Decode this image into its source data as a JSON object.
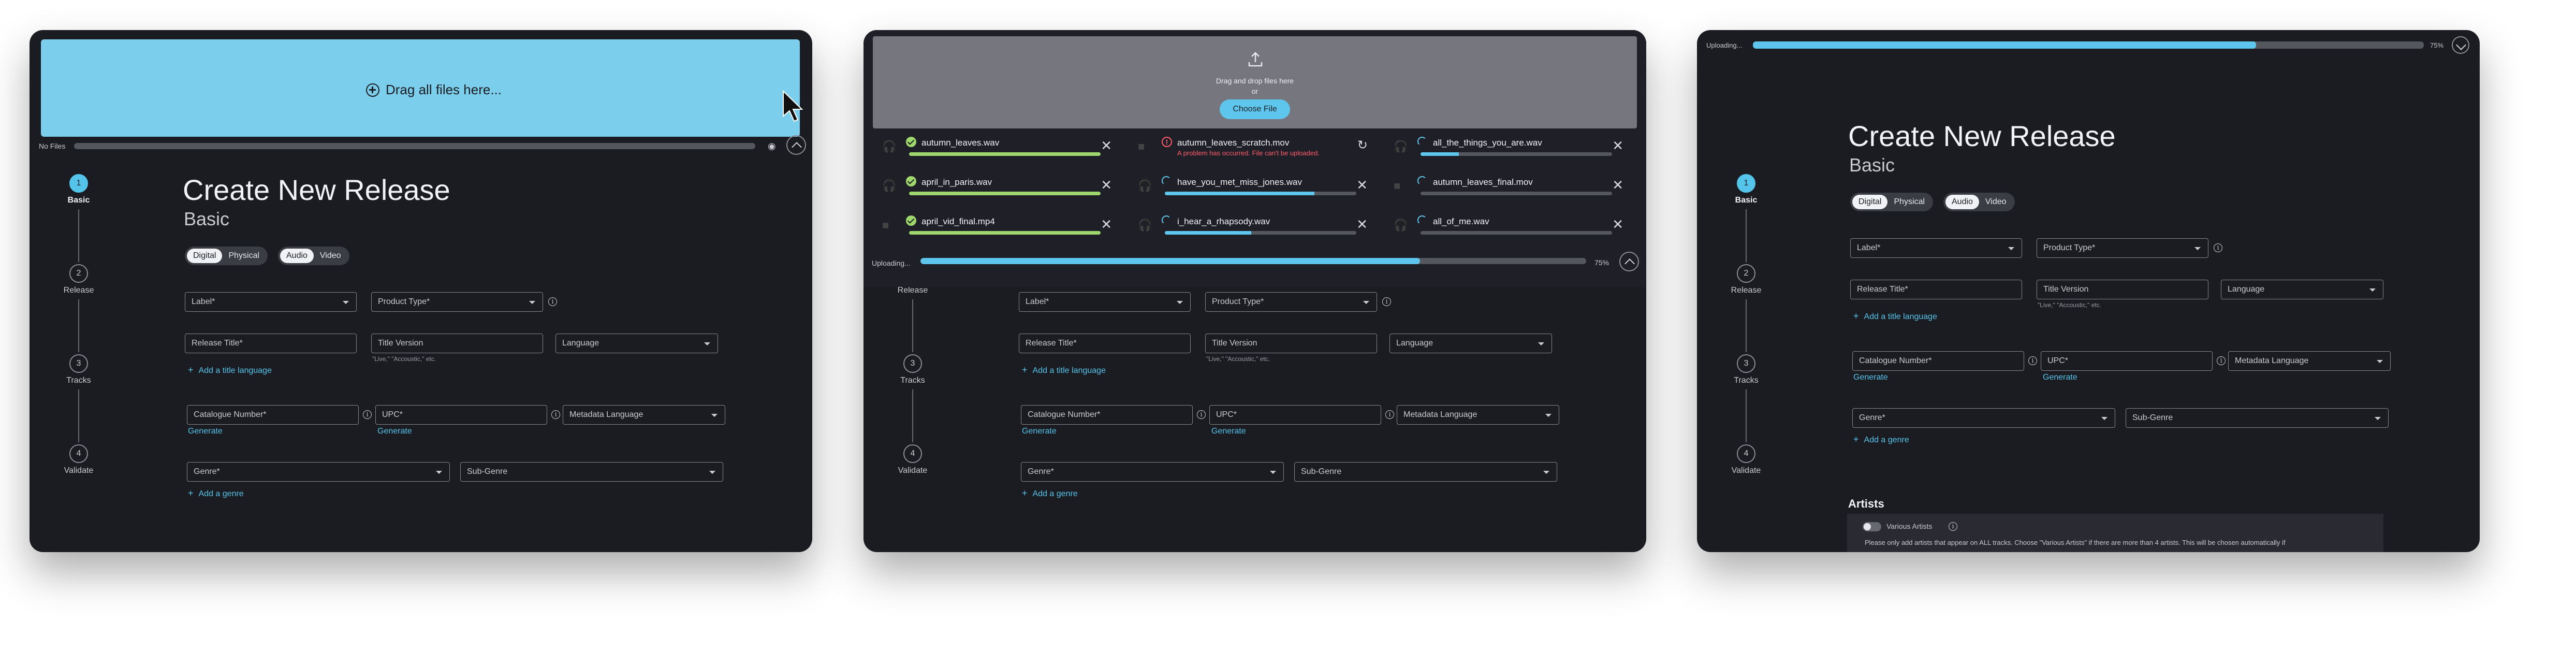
{
  "colors": {
    "accent": "#5ec6ec",
    "success": "#9ed86c",
    "error": "#ff5b6b",
    "panel": "#1b1c22"
  },
  "icons": {
    "plus_circle": "plus-circle-icon",
    "upload": "upload-icon",
    "headphones": "headphones-icon",
    "video": "video-icon",
    "close": "close-icon",
    "retry": "retry-icon",
    "info": "info-icon",
    "chevron": "chevron-icon",
    "eye": "eye-icon",
    "cursor": "cursor-icon"
  },
  "stepper": {
    "steps": [
      {
        "num": "1",
        "label": "Basic"
      },
      {
        "num": "2",
        "label": "Release"
      },
      {
        "num": "3",
        "label": "Tracks"
      },
      {
        "num": "4",
        "label": "Validate"
      }
    ]
  },
  "form": {
    "title": "Create New Release",
    "subtitle": "Basic",
    "format_toggle": [
      "Digital",
      "Physical"
    ],
    "media_toggle": [
      "Audio",
      "Video"
    ],
    "label_field": "Label*",
    "product_type_field": "Product Type*",
    "release_title_field": "Release Title*",
    "title_version_field": "Title Version",
    "title_version_hint": "\"Live,\" \"Accoustic,\" etc.",
    "language_field": "Language",
    "add_title_language": "Add a title language",
    "catalogue_field": "Catalogue Number*",
    "upc_field": "UPC*",
    "metadata_language_field": "Metadata Language",
    "generate": "Generate",
    "genre_field": "Genre*",
    "subgenre_field": "Sub-Genre",
    "add_genre": "Add a genre",
    "info_glyph": "i"
  },
  "panel1": {
    "dropzone_text": "Drag all files here...",
    "no_files": "No Files",
    "progress": 0
  },
  "panel2": {
    "drop_text": "Drag and drop files here",
    "or": "or",
    "choose_file": "Choose File",
    "uploading": "Uploading...",
    "progress": 75,
    "progress_label": "75%",
    "files": [
      {
        "name": "autumn_leaves.wav",
        "kind": "audio",
        "status": "done",
        "progress": 100
      },
      {
        "name": "autumn_leaves_scratch.mov",
        "kind": "video",
        "status": "error",
        "progress": 0,
        "message": "A problem has occurred. File can't be uploaded."
      },
      {
        "name": "all_the_things_you_are.wav",
        "kind": "audio",
        "status": "uploading",
        "progress": 20
      },
      {
        "name": "april_in_paris.wav",
        "kind": "audio",
        "status": "done",
        "progress": 100
      },
      {
        "name": "have_you_met_miss_jones.wav",
        "kind": "audio",
        "status": "uploading",
        "progress": 78
      },
      {
        "name": "autumn_leaves_final.mov",
        "kind": "video",
        "status": "uploading",
        "progress": 0
      },
      {
        "name": "april_vid_final.mp4",
        "kind": "video",
        "status": "done",
        "progress": 100
      },
      {
        "name": "i_hear_a_rhapsody.wav",
        "kind": "audio",
        "status": "uploading",
        "progress": 45
      },
      {
        "name": "all_of_me.wav",
        "kind": "audio",
        "status": "uploading",
        "progress": 0
      }
    ]
  },
  "panel3": {
    "uploading": "Uploading...",
    "progress": 75,
    "progress_label": "75%",
    "artists_heading": "Artists",
    "various_artists": "Various Artists",
    "artists_note": "Please only add artists that appear on ALL tracks. Choose \"Various Artists\" if there are more than 4 artists. This will be chosen automatically if"
  }
}
